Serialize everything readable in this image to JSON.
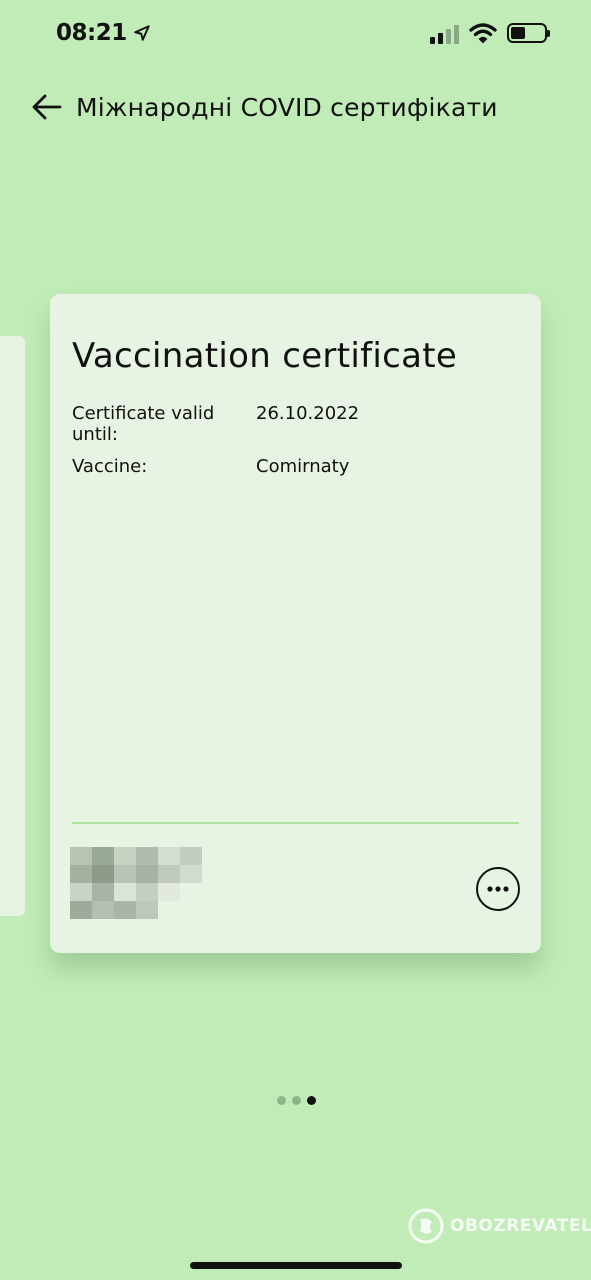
{
  "status_bar": {
    "time": "08:21",
    "location_icon": "location-arrow-icon",
    "signal_icon": "cellular-signal-icon",
    "wifi_icon": "wifi-icon",
    "battery_icon": "battery-icon",
    "battery_level": 0.45
  },
  "header": {
    "back_icon": "arrow-left-icon",
    "title": "Міжнародні COVID сертифікати"
  },
  "certificate": {
    "title": "Vaccination certificate",
    "valid_until_label": "Certificate valid until:",
    "valid_until_value": "26.10.2022",
    "vaccine_label": "Vaccine:",
    "vaccine_value": "Comirnaty",
    "more_icon": "more-horizontal-icon"
  },
  "pager": {
    "total": 3,
    "active_index": 2
  },
  "watermark": {
    "text": "OBOZREVATEL"
  },
  "colors": {
    "background": "#c2ecb7",
    "card": "#e7f4e3",
    "divider": "#aee29f",
    "text": "#111111"
  }
}
